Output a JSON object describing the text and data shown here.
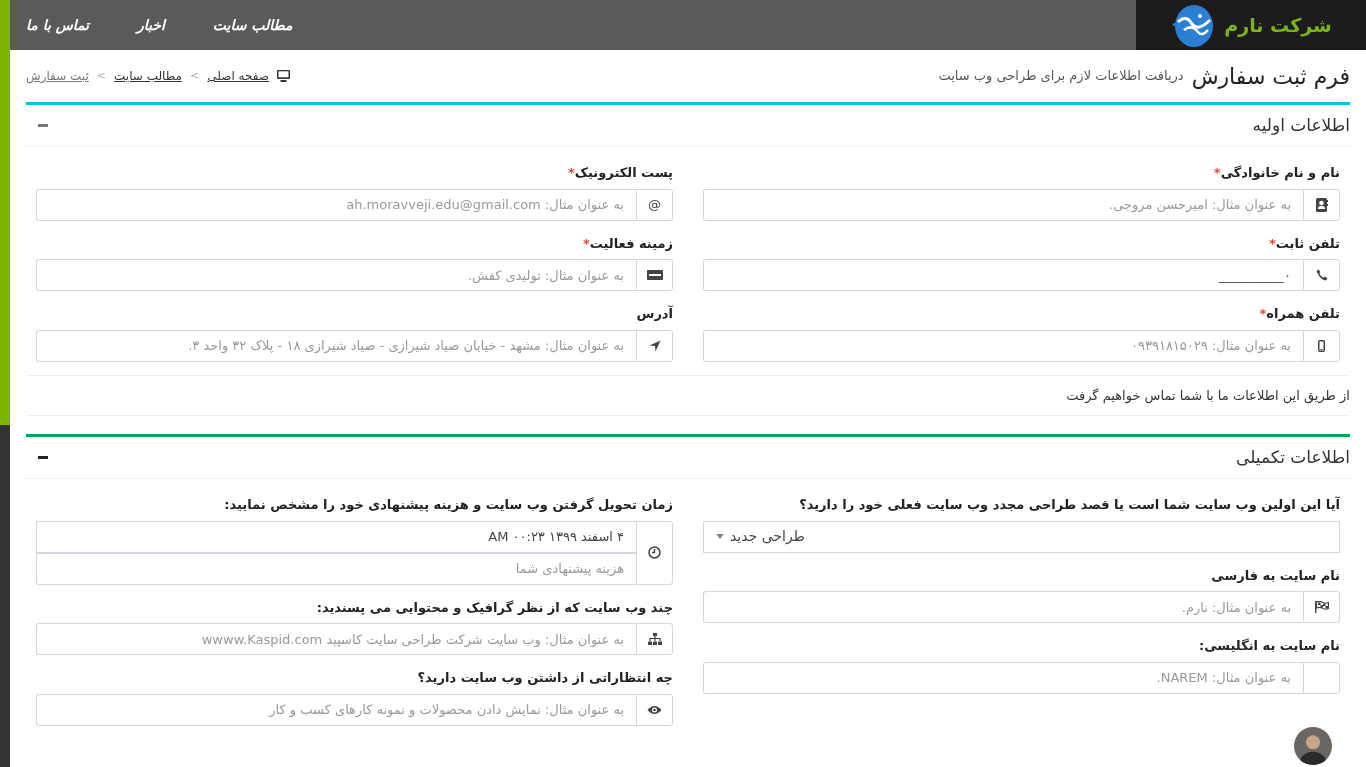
{
  "navbar": {
    "brand": "شرکت نارم",
    "links": [
      {
        "label": "مطالب سایت"
      },
      {
        "label": "اخبار"
      },
      {
        "label": "تماس با ما"
      }
    ]
  },
  "page_header": {
    "title": "فرم ثبت سفارش",
    "subtitle": "دریافت اطلاعات لازم برای طراحی وب سایت"
  },
  "breadcrumb": {
    "separator": ">",
    "items": [
      {
        "label": "صفحه اصلی"
      },
      {
        "label": "مطالب سایت"
      },
      {
        "label": "ثبت سفارش"
      }
    ]
  },
  "boxes": [
    {
      "title": "اطلاعات اولیه",
      "color": "#00c0ef",
      "columns": [
        [
          {
            "kind": "input",
            "label": "نام و نام خانوادگی",
            "required_mark": "*",
            "placeholder": "به عنوان مثال: امیرحسن مروجی."
          },
          {
            "kind": "input",
            "label": "تلفن ثابت",
            "required_mark": "*",
            "value": "۰__________"
          },
          {
            "kind": "input",
            "label": "تلفن همراه",
            "required_mark": "*",
            "placeholder": "به عنوان مثال: ۰۹۳۹۱۸۱۵۰۲۹"
          }
        ],
        [
          {
            "kind": "input",
            "label": "پست الکترونیک",
            "required_mark": "*",
            "addon_text": "@",
            "placeholder": "به عنوان مثال: ah.moravveji.edu@gmail.com"
          },
          {
            "kind": "input",
            "label": "زمینه فعالیت",
            "required_mark": "*",
            "placeholder": "به عنوان مثال: تولیدی کفش."
          },
          {
            "kind": "input",
            "label": "آدرس",
            "placeholder": "به عنوان مثال: مشهد - خیابان صیاد شیرازی - صیاد شیرازی ۱۸ - پلاک ۳۲ واحد ۳."
          }
        ]
      ],
      "footer": "از طریق این اطلاعات ما با شما تماس خواهیم گرفت"
    },
    {
      "title": "اطلاعات تکمیلی",
      "color": "#00a65a",
      "columns": [
        [
          {
            "kind": "select",
            "label": "آیا این اولین وب سایت شما است یا قصد طراحی مجدد وب سایت فعلی خود را دارید؟",
            "value": "طراحی جدید"
          },
          {
            "kind": "input",
            "label": "نام سایت به فارسی",
            "placeholder": "به عنوان مثال: نارم."
          },
          {
            "kind": "input",
            "label": "نام سایت به انگلیسی:",
            "placeholder": "به عنوان مثال: NAREM."
          }
        ],
        [
          {
            "kind": "datetime_cost",
            "label": "زمان تحویل گرفتن وب سایت و هزینه پیشنهادی خود را مشخص نمایید:",
            "value": "۴ اسفند ۱۳۹۹ ۰۰:۲۳ AM",
            "placeholder": "هزینه پیشنهادی شما"
          },
          {
            "kind": "input",
            "label": "چند وب سایت که از نظر گرافیک و محتوایی می پسندید:",
            "placeholder": "به عنوان مثال: وب سایت شرکت طراحی سایت کاسپید wwww.Kaspid.com"
          },
          {
            "kind": "input",
            "label": "چه انتظاراتی از داشتن وب سایت دارید؟",
            "placeholder": "به عنوان مثال: نمایش دادن محصولات و نمونه کارهای کسب و کار"
          }
        ]
      ]
    }
  ]
}
